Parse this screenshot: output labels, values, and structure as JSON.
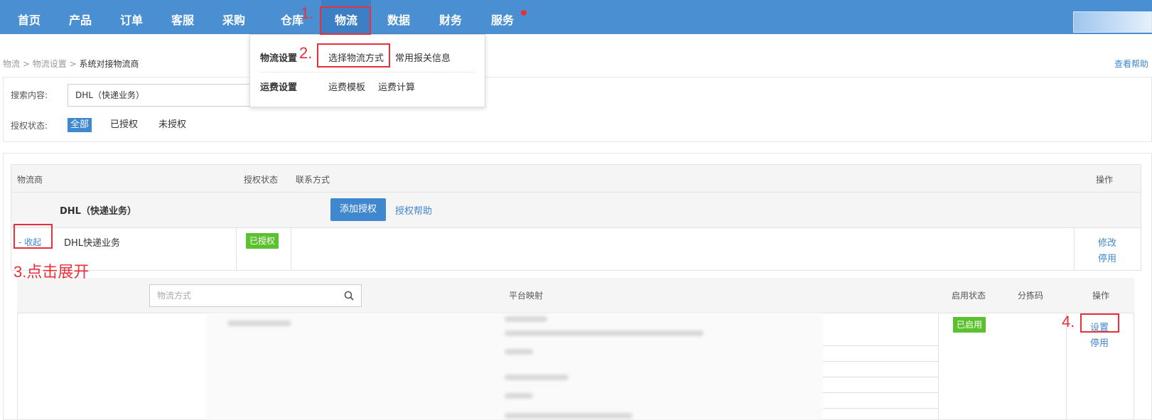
{
  "nav": {
    "items": [
      "首页",
      "产品",
      "订单",
      "客服",
      "采购",
      "仓库",
      "物流",
      "数据",
      "财务",
      "服务"
    ]
  },
  "dropdown": {
    "logistics_settings": "物流设置",
    "select_method": "选择物流方式",
    "customs_info": "常用报关信息",
    "freight_settings": "运费设置",
    "freight_template": "运费模板",
    "freight_calc": "运费计算"
  },
  "breadcrumb": {
    "a": "物流",
    "b": "物流设置",
    "c": "系统对接物流商"
  },
  "help": "查看帮助",
  "filter": {
    "search_label": "搜索内容:",
    "search_value": "DHL（快递业务）",
    "status_label": "授权状态:",
    "status_all": "全部",
    "status_authorized": "已授权",
    "status_unauthorized": "未授权"
  },
  "table": {
    "headers": {
      "carrier": "物流商",
      "auth_status": "授权状态",
      "contact": "联系方式",
      "ops": "操作"
    },
    "group_name": "DHL（快递业务）",
    "add_auth": "添加授权",
    "auth_help": "授权帮助",
    "row": {
      "collapse": "- 收起",
      "name": "DHL快递业务",
      "status": "已授权",
      "edit": "修改",
      "disable": "停用"
    }
  },
  "subtable": {
    "search_placeholder": "物流方式",
    "headers": {
      "platform_map": "平台映射",
      "enabled": "启用状态",
      "sort_code": "分拣码",
      "ops": "操作"
    },
    "enabled_badge": "已启用",
    "set": "设置",
    "disable": "停用"
  },
  "annotations": {
    "step1": "1.",
    "step2": "2.",
    "step3": "3.点击展开",
    "step4": "4."
  },
  "colors": {
    "nav_bg": "#4a8fd1",
    "accent": "#3f87cf",
    "green": "#5cc12f",
    "annotation": "#e8303a"
  }
}
